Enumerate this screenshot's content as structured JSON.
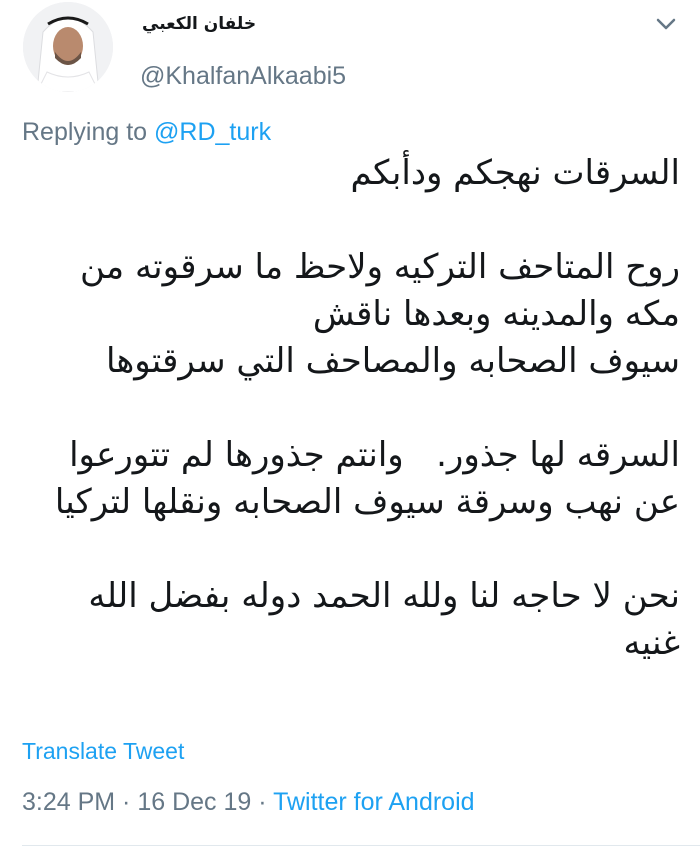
{
  "author": {
    "display_name": "خلفان الكعبي",
    "handle": "@KhalfanAlkaabi5",
    "avatar_icon": "user-avatar"
  },
  "menu": {
    "icon": "chevron-down-icon"
  },
  "reply": {
    "prefix": "Replying to ",
    "mention": "@RD_turk"
  },
  "tweet": {
    "lines": [
      "السرقات نهجكم ودأبكم",
      "",
      "روح المتاحف التركيه ولاحظ ما سرقوته من",
      "مكه والمدينه وبعدها ناقش",
      "سيوف الصحابه والمصاحف التي سرقتوها",
      "",
      "السرقه لها جذور.   وانتم جذورها لم تتورعوا",
      "عن نهب وسرقة سيوف الصحابه ونقلها لتركيا",
      "",
      "نحن لا حاجه لنا ولله الحمد دوله بفضل الله",
      "غنيه"
    ]
  },
  "actions": {
    "translate_label": "Translate Tweet"
  },
  "meta": {
    "time": "3:24 PM",
    "sep1": " · ",
    "date": "16 Dec 19",
    "sep2": " · ",
    "source": "Twitter for Android"
  },
  "colors": {
    "link": "#1da1f2",
    "secondary": "#657786",
    "text": "#14171a"
  }
}
